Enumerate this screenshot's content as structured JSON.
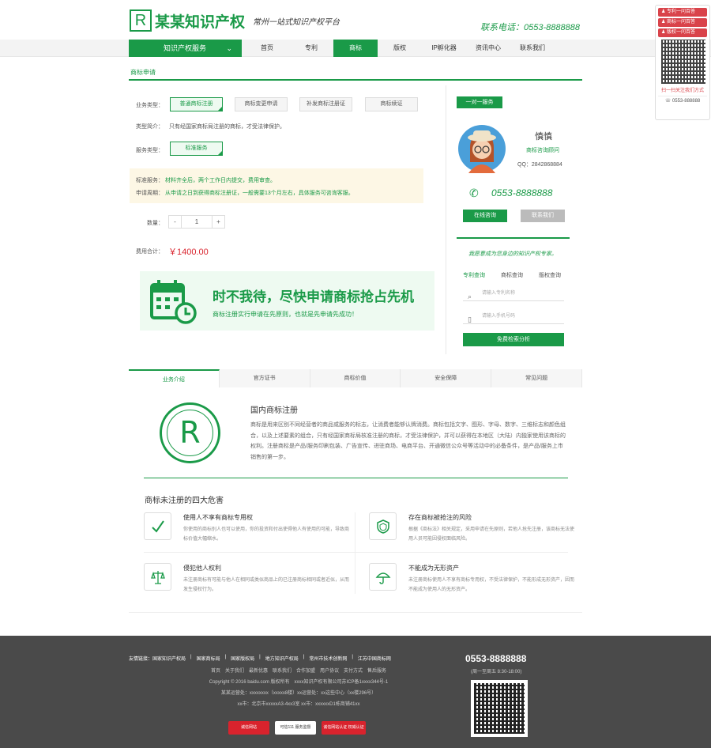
{
  "header": {
    "logo_mark": "R",
    "logo_name": "某某知识产权",
    "slogan": "常州一站式知识产权平台",
    "phone": "联系电话：0553-8888888"
  },
  "nav": {
    "service_menu": "知识产权服务",
    "items": [
      "首页",
      "专利",
      "商标",
      "版权",
      "IP孵化器",
      "资讯中心",
      "联系我们"
    ],
    "active_index": 2
  },
  "float_sidebar": {
    "buttons": [
      "专利一问百答",
      "商标一问百答",
      "版权一问百答"
    ],
    "follow_text": "扫一扫关注我们方式",
    "phone": "0553-888888"
  },
  "breadcrumb": "商标申请",
  "order": {
    "business_type_label": "业务类型：",
    "business_types": [
      "普通商标注册",
      "商标变更申请",
      "补发商标注册证",
      "商标续证"
    ],
    "intro_label": "类型简介：",
    "intro_text": "只有经国家商标局注册的商标，才受法律保护。",
    "service_type_label": "服务类型：",
    "service_type": "标准服务",
    "notice_service_label": "标准服务：",
    "notice_service": "材料齐全后，两个工作日内提交，费用审查。",
    "notice_time_label": "申请周期：",
    "notice_time": "从申请之日到获得商标注册证，一般需要13个月左右，具体服务可咨询客服。",
    "qty_label": "数量：",
    "qty_minus": "-",
    "qty_value": "1",
    "qty_plus": "+",
    "total_label": "费用合计：",
    "total_value": "￥1400.00"
  },
  "promo": {
    "title": "时不我待，尽快申请商标抢占先机",
    "subtitle": "商标注册实行申请在先原则，也就是先申请先成功！"
  },
  "consultant": {
    "badge": "一对一服务",
    "name": "慎慎",
    "role": "商标咨询顾问",
    "qq": "QQ：2842868884",
    "phone": "0553-8888888",
    "online_btn": "在线咨询",
    "contact_btn": "联系我们",
    "slogan": "我愿意成为您身边的知识产权专家。",
    "tabs": [
      "专利查询",
      "商标查询",
      "版权查询"
    ],
    "search_placeholder": "请输入专利名称",
    "phone_placeholder": "请输入手机号码",
    "submit": "免费检索分析"
  },
  "tabs": [
    "业务介绍",
    "官方证书",
    "商标价值",
    "安全保障",
    "常见问题"
  ],
  "intro": {
    "mark": "R",
    "title": "国内商标注册",
    "body": "商标是用来区别不同经营者的商品或服务的标志，让消费者能够认牌消费。商标包括文字、图形、字母、数字、三维标志和颜色组合，以及上述要素的组合，只有经国家商标局核准注册的商标，才受法律保护，并可以获得在本地区（大陆）内独家使用该商标的权利。注册商标是产品/服务印刷包装、广告宣传、进驻商场、电商平台、开通微信公众号等活动中的必备条件，是产品/服务上市销售的第一步。"
  },
  "risks": {
    "title": "商标未注册的四大危害",
    "items": [
      {
        "title": "使用人不享有商标专用权",
        "desc": "你使用的商标别人也可以使用，你的投资和付出使得他人有使用的可能，导致商标价值大幅缩水。"
      },
      {
        "title": "存在商标被抢注的风险",
        "desc": "根据《商标法》相关规定，采用申请在先原则，若他人抢先注册，该商标无法使用人员可能因侵权面临风险。"
      },
      {
        "title": "侵犯他人权利",
        "desc": "未注册商标有可能与他人在相同或类似商品上的已注册商标相同或者近似，从而发生侵权行为。"
      },
      {
        "title": "不能成为无形资产",
        "desc": "未注册商标使用人不享有商标专用权，不受法律保护，不能形成无形资产，因而不能成为使用人的无形资产。"
      }
    ]
  },
  "footer": {
    "links": [
      "友情链接：国家知识产权局",
      "国家商标局",
      "国家版权局",
      "地方知识产权局",
      "常州市技术创新网",
      "江苏中国商标网"
    ],
    "nav": "首页　关于我们　最新优惠　联系我们　合作加盟　用户协议　支付方式　售后服务",
    "copyright": "Copyright © 2016 baidu.com 版权所有　xxxx知识产权有限公司苏ICP备1xxxx344号-1",
    "address1": "某某运营处：xxxxxxxx（xxxxx8楼）xx运营处：xx这些中心（xx楼296号）",
    "address2": "xx市：北京市xxxxxA3-4xx3室 xx市：xxxxxxD1栋商铺41xx",
    "phone": "0553-8888888",
    "hours": "(周一至周五 8:30-18:00)",
    "badges": [
      "诚信网站",
      "可信111 服务监督",
      "诚信网站认证 权威认证"
    ]
  }
}
